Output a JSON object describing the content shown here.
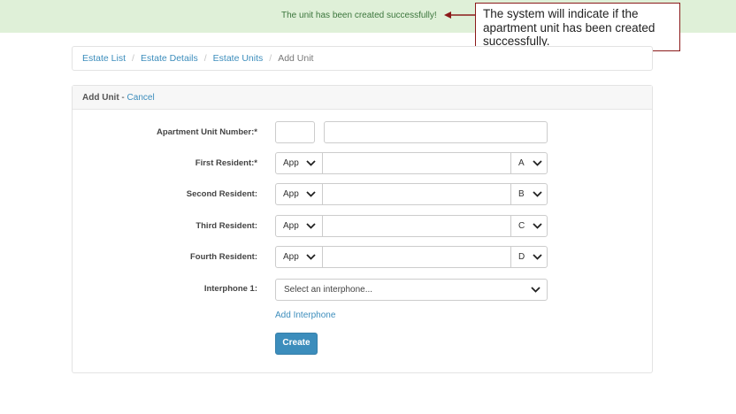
{
  "alert": {
    "message": "The unit has been created successfully!"
  },
  "callout": {
    "text": "The system will indicate if the apartment unit has been created successfully."
  },
  "breadcrumb": {
    "items": [
      {
        "label": "Estate List"
      },
      {
        "label": "Estate Details"
      },
      {
        "label": "Estate Units"
      },
      {
        "label": "Add Unit"
      }
    ]
  },
  "panel": {
    "title": "Add Unit",
    "separator": " - ",
    "cancel_label": "Cancel"
  },
  "form": {
    "unit_number_label": "Apartment Unit Number:*",
    "residents": [
      {
        "label": "First Resident:*",
        "type": "App",
        "slot": "A"
      },
      {
        "label": "Second Resident:",
        "type": "App",
        "slot": "B"
      },
      {
        "label": "Third Resident:",
        "type": "App",
        "slot": "C"
      },
      {
        "label": "Fourth Resident:",
        "type": "App",
        "slot": "D"
      }
    ],
    "interphone_label": "Interphone 1:",
    "interphone_placeholder": "Select an interphone...",
    "add_interphone_label": "Add Interphone",
    "create_label": "Create"
  },
  "colors": {
    "accent": "#3c8dbc",
    "success_bg": "#dff0d8",
    "success_text": "#3c763d",
    "callout_border": "#8b1a1a"
  }
}
